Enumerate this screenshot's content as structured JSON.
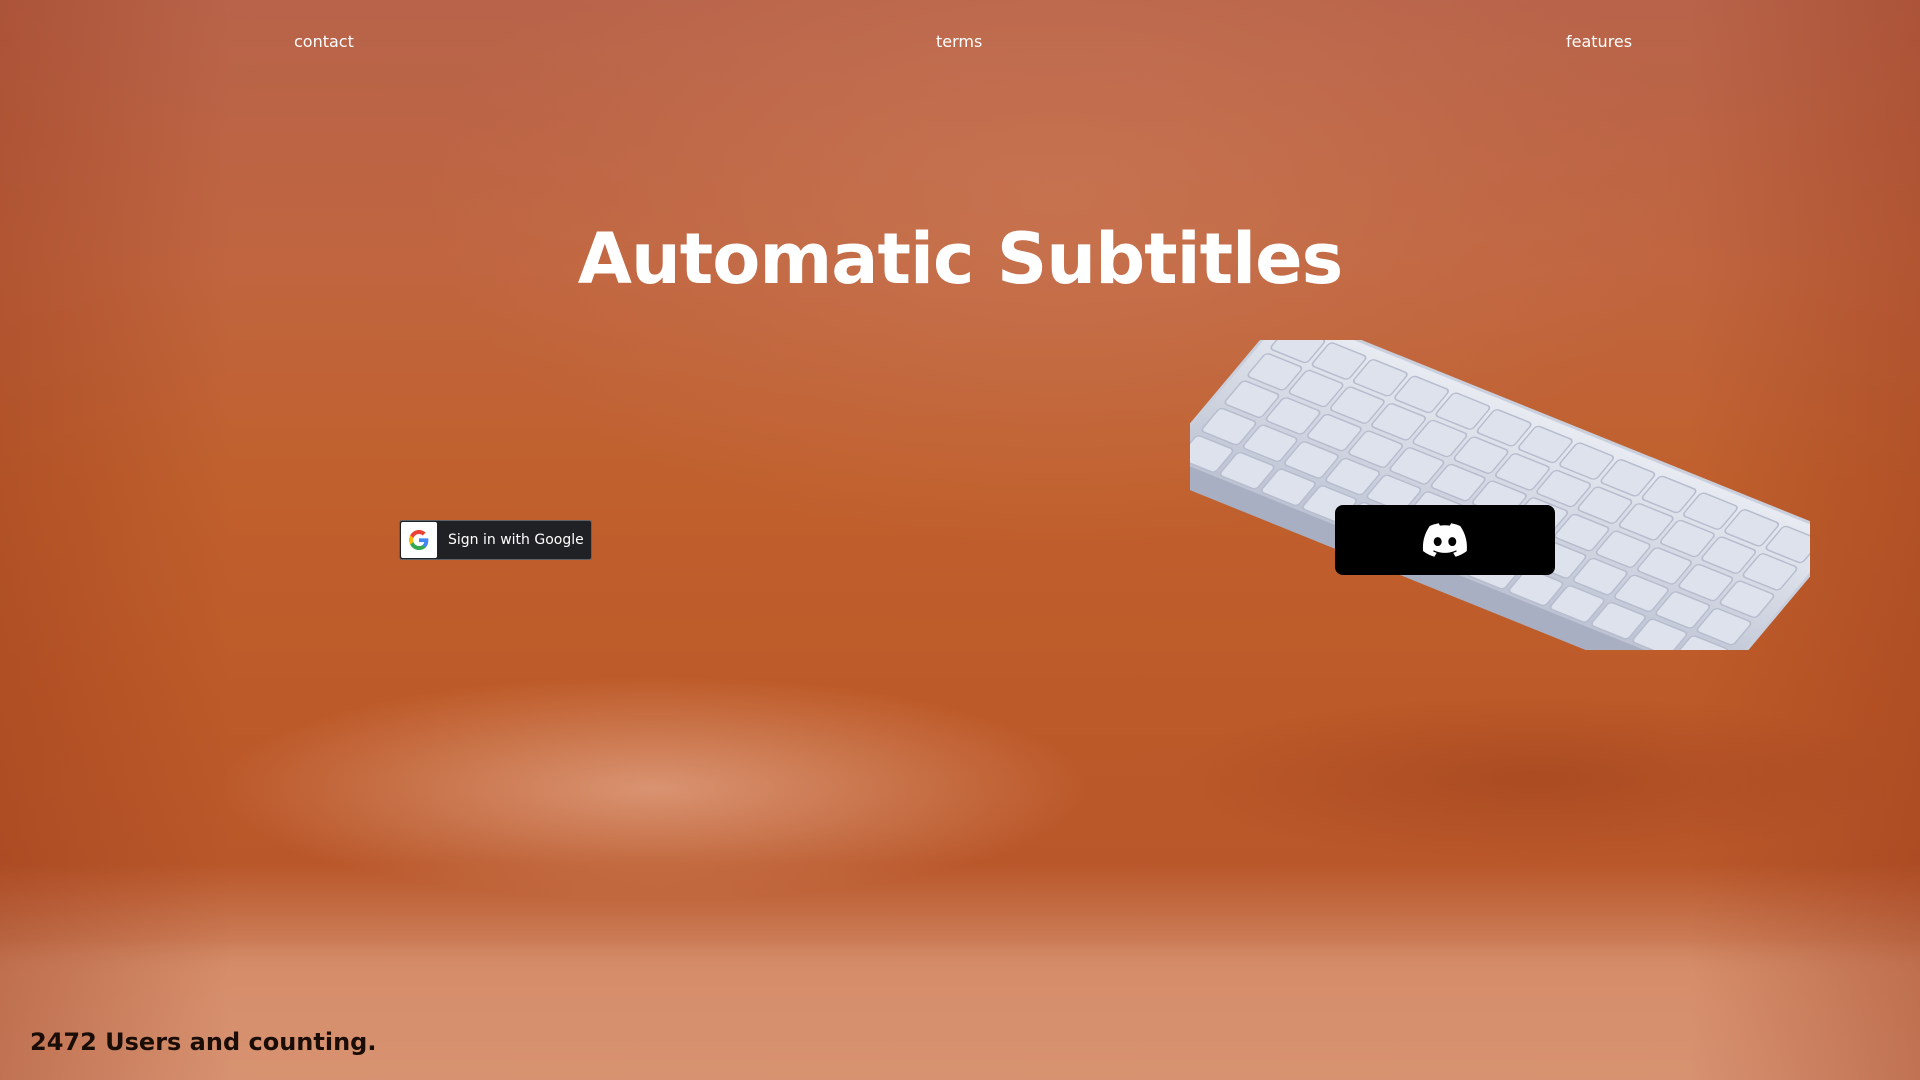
{
  "nav": {
    "contact": "contact",
    "terms": "terms",
    "features": "features"
  },
  "hero": {
    "title": "Automatic Subtitles"
  },
  "auth": {
    "google_label": "Sign in with Google",
    "google_icon": "google-g-icon",
    "discord_icon": "discord-icon"
  },
  "footer": {
    "users_count": "2472 Users and counting."
  },
  "colors": {
    "background": "#c0602d",
    "google_button": "#202124",
    "discord_button": "#000000",
    "keyboard": "#d6dbe6"
  }
}
